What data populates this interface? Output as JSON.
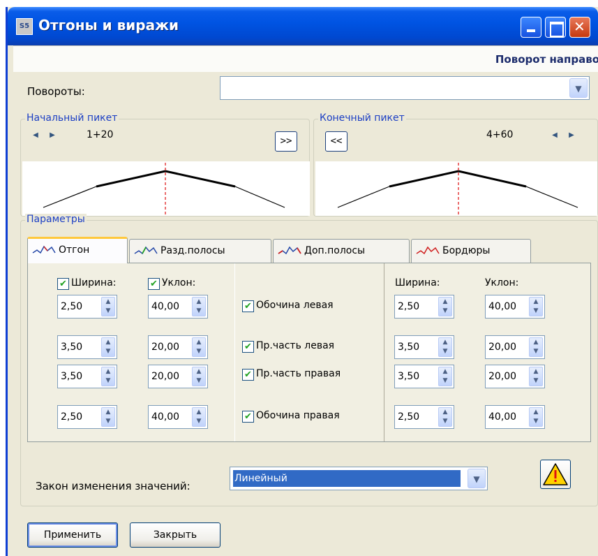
{
  "window": {
    "title": "Отгоны и виражи",
    "app_icon_text": "S5"
  },
  "header": {
    "turn_direction": "Поворот направо"
  },
  "turns": {
    "label": "Повороты:",
    "selected": ""
  },
  "start_picket": {
    "title": "Начальный пикет",
    "value": "1+20",
    "jump_label": ">>"
  },
  "end_picket": {
    "title": "Конечный пикет",
    "value": "4+60",
    "jump_label": "<<"
  },
  "params": {
    "title": "Параметры",
    "tabs": [
      {
        "label": "Отгон",
        "active": true,
        "icon": "otgon-icon"
      },
      {
        "label": "Разд.полосы",
        "active": false,
        "icon": "divider-strip-icon"
      },
      {
        "label": "Доп.полосы",
        "active": false,
        "icon": "extra-lanes-icon"
      },
      {
        "label": "Бордюры",
        "active": false,
        "icon": "curbs-icon"
      }
    ],
    "left": {
      "width_label": "Ширина:",
      "slope_label": "Уклон:",
      "width_checked": true,
      "slope_checked": true,
      "rows": [
        {
          "width": "2,50",
          "slope": "40,00"
        },
        {
          "width": "3,50",
          "slope": "20,00"
        },
        {
          "width": "3,50",
          "slope": "20,00"
        },
        {
          "width": "2,50",
          "slope": "40,00"
        }
      ]
    },
    "middle": {
      "rows": [
        {
          "label": "Обочина левая",
          "checked": true
        },
        {
          "label": "Пр.часть левая",
          "checked": true
        },
        {
          "label": "Пр.часть правая",
          "checked": true
        },
        {
          "label": "Обочина правая",
          "checked": true
        }
      ]
    },
    "right": {
      "width_label": "Ширина:",
      "slope_label": "Уклон:",
      "rows": [
        {
          "width": "2,50",
          "slope": "40,00"
        },
        {
          "width": "3,50",
          "slope": "20,00"
        },
        {
          "width": "3,50",
          "slope": "20,00"
        },
        {
          "width": "2,50",
          "slope": "40,00"
        }
      ]
    },
    "law_label": "Закон изменения значений:",
    "law_value": "Линейный"
  },
  "buttons": {
    "apply": "Применить",
    "close": "Закрыть"
  },
  "colors": {
    "titlebar": "#0054e3",
    "group_title": "#1c3fc4",
    "selection": "#316ac5",
    "profile_axis": "#e02020",
    "warning": "#ffd200"
  }
}
